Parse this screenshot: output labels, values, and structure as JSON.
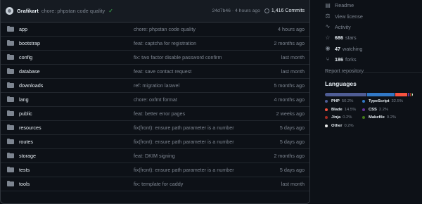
{
  "commit": {
    "author": "Grafikart",
    "message": "chore: phpstan code quality",
    "check": "✓",
    "sha": "24d7b46",
    "time": "4 hours ago",
    "commits": "1,416 Commits"
  },
  "files": [
    {
      "name": "app",
      "message": "chore: phpstan code quality",
      "time": "4 hours ago"
    },
    {
      "name": "bootstrap",
      "message": "feat: captcha for registration",
      "time": "2 months ago"
    },
    {
      "name": "config",
      "message": "fix: two factor disable password confirm",
      "time": "last month"
    },
    {
      "name": "database",
      "message": "feat: save contact request",
      "time": "last month"
    },
    {
      "name": "downloads",
      "message": "ref: migration laravel",
      "time": "5 months ago"
    },
    {
      "name": "lang",
      "message": "chore: oxfmt format",
      "time": "4 months ago"
    },
    {
      "name": "public",
      "message": "feat: better error pages",
      "time": "2 weeks ago"
    },
    {
      "name": "resources",
      "message": "fix(front): ensure path parameter is a number",
      "time": "5 days ago"
    },
    {
      "name": "routes",
      "message": "fix(front): ensure path parameter is a number",
      "time": "5 days ago"
    },
    {
      "name": "storage",
      "message": "feat: DKIM signing",
      "time": "2 months ago"
    },
    {
      "name": "tests",
      "message": "fix(front): ensure path parameter is a number",
      "time": "5 days ago"
    },
    {
      "name": "tools",
      "message": "fix: template for caddy",
      "time": "last month"
    }
  ],
  "sidebar": {
    "readme": "Readme",
    "license": "View license",
    "activity": "Activity",
    "stars_num": "686",
    "stars_label": "stars",
    "watching_num": "47",
    "watching_label": "watching",
    "forks_num": "186",
    "forks_label": "forks",
    "report": "Report repository"
  },
  "languages": {
    "title": "Languages",
    "items": [
      {
        "name": "PHP",
        "pct": "50.2%",
        "value": 50.2,
        "color": "#4F5D95"
      },
      {
        "name": "TypeScript",
        "pct": "32.5%",
        "value": 32.5,
        "color": "#3178c6"
      },
      {
        "name": "Blade",
        "pct": "14.5%",
        "value": 14.5,
        "color": "#f7523f"
      },
      {
        "name": "CSS",
        "pct": "2.2%",
        "value": 2.2,
        "color": "#663399"
      },
      {
        "name": "Jinja",
        "pct": "0.2%",
        "value": 0.2,
        "color": "#a52a22"
      },
      {
        "name": "Makefile",
        "pct": "0.2%",
        "value": 0.2,
        "color": "#427819"
      },
      {
        "name": "Other",
        "pct": "0.2%",
        "value": 0.2,
        "color": "#ededed"
      }
    ]
  }
}
